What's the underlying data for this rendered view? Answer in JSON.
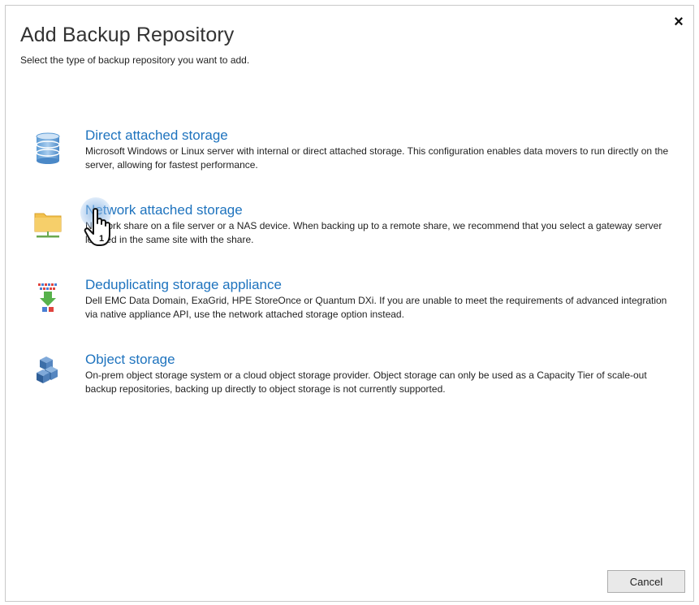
{
  "dialog": {
    "title": "Add Backup Repository",
    "subtitle": "Select the type of backup repository you want to add.",
    "close_glyph": "×"
  },
  "options": [
    {
      "title": "Direct attached storage",
      "description": "Microsoft Windows or Linux server with internal or direct attached storage. This configuration enables data movers to run directly on the server, allowing for fastest performance.",
      "icon": "database-icon"
    },
    {
      "title": "Network attached storage",
      "description": "Network share on a file server or a NAS device. When backing up to a remote share, we recommend that you select a gateway server located in the same site with the share.",
      "icon": "network-folder-icon"
    },
    {
      "title": "Deduplicating storage appliance",
      "description": "Dell EMC Data Domain, ExaGrid, HPE StoreOnce or Quantum DXi. If you are unable to meet the requirements of advanced integration via native appliance API, use the network attached storage option instead.",
      "icon": "deduplication-icon"
    },
    {
      "title": "Object storage",
      "description": "On-prem object storage system or a cloud object storage provider. Object storage can only be used as a Capacity Tier of scale-out backup repositories, backing up directly to object storage is not currently supported.",
      "icon": "object-storage-icon"
    }
  ],
  "footer": {
    "cancel_label": "Cancel"
  },
  "cursor": {
    "badge": "1",
    "icon": "hand-pointer-icon"
  },
  "colors": {
    "link": "#1e73be",
    "text": "#1f1f1f"
  }
}
